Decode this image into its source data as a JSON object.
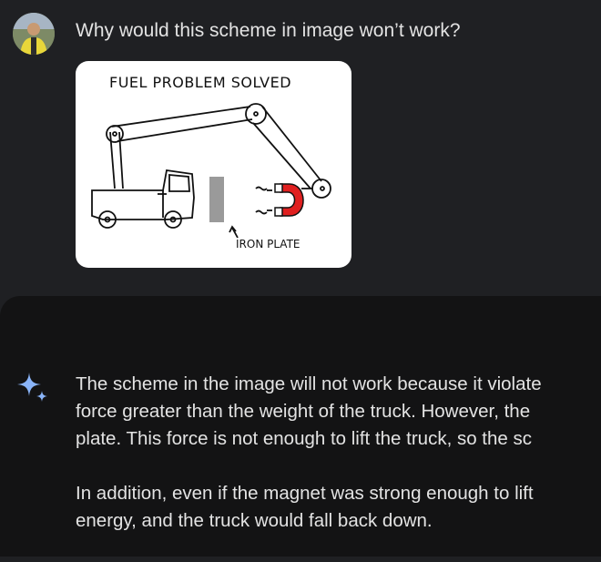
{
  "user": {
    "avatar_icon": "user-avatar-photo",
    "prompt": "Why would this scheme in image won’t work?"
  },
  "attachment": {
    "title": "FUEL PROBLEM SOLVED",
    "label": "IRON PLATE",
    "colors": {
      "magnet": "#e02020",
      "plate": "#9a9a9a"
    }
  },
  "response": {
    "icon": "gemini-sparkle-icon",
    "paragraphs": [
      {
        "lines": [
          "The scheme in the image will not work because it violate",
          "force greater than the weight of the truck. However, the",
          "plate. This force is not enough to lift the truck, so the sc"
        ]
      },
      {
        "lines": [
          "In addition, even if the magnet was strong enough to lift",
          "energy, and the truck would fall back down."
        ]
      }
    ]
  },
  "colors": {
    "page_bg": "#1f2023",
    "response_bg": "#131314",
    "text": "#e3e3e3",
    "sparkle": "#8ab4f8"
  }
}
